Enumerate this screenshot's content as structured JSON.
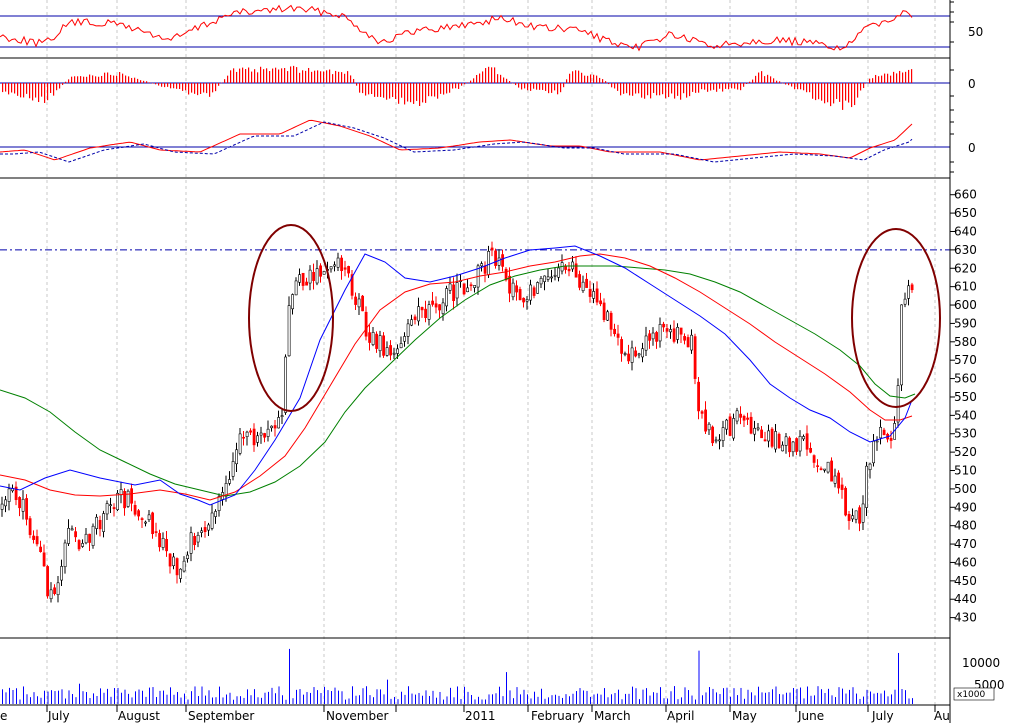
{
  "chart_data": [
    {
      "type": "line",
      "panel": "oscillator",
      "levels": [
        70,
        30
      ],
      "ytick_labels": [
        "50"
      ],
      "color": "#ff0000"
    },
    {
      "type": "bar",
      "panel": "macd-histogram",
      "ytick_labels": [
        "0"
      ],
      "color": "#ff0000"
    },
    {
      "type": "line",
      "panel": "macd",
      "ytick_labels": [
        "0"
      ],
      "series": [
        {
          "style": "solid",
          "color": "#ff0000"
        },
        {
          "style": "dashed",
          "color": "#0000aa"
        }
      ]
    },
    {
      "type": "candlestick",
      "panel": "price",
      "y_range": [
        420,
        668
      ],
      "yticks": [
        660,
        650,
        640,
        630,
        620,
        610,
        600,
        590,
        580,
        570,
        560,
        550,
        540,
        530,
        520,
        510,
        500,
        490,
        480,
        470,
        460,
        450,
        440,
        430
      ],
      "ytick_labels": [
        "660",
        "650",
        "640",
        "630",
        "620",
        "610",
        "600",
        "590",
        "580",
        "570",
        "560",
        "550",
        "540",
        "530",
        "520",
        "510",
        "500",
        "490",
        "480",
        "470",
        "460",
        "450",
        "440",
        "430"
      ],
      "resistance_line": 630,
      "x_labels": [
        "e",
        "July",
        "August",
        "September",
        "November",
        "2011",
        "February",
        "March",
        "April",
        "May",
        "June",
        "July",
        "Au"
      ],
      "colors": {
        "up": "#000000",
        "down": "#ff0000",
        "ma_short": "#0000ff",
        "ma_mid": "#ff0000",
        "ma_long": "#008000",
        "circle": "#800000"
      },
      "moving_averages": {
        "short": [
          [
            0,
            486
          ],
          [
            20,
            490
          ],
          [
            45,
            478
          ],
          [
            70,
            470
          ],
          [
            100,
            478
          ],
          [
            135,
            485
          ],
          [
            160,
            480
          ],
          [
            180,
            494
          ],
          [
            198,
            500
          ],
          [
            210,
            505
          ],
          [
            235,
            495
          ],
          [
            255,
            470
          ],
          [
            275,
            440
          ],
          [
            300,
            398
          ],
          [
            320,
            340
          ],
          [
            345,
            290
          ],
          [
            365,
            254
          ],
          [
            385,
            262
          ],
          [
            405,
            278
          ],
          [
            430,
            282
          ],
          [
            455,
            276
          ],
          [
            480,
            268
          ],
          [
            505,
            258
          ],
          [
            530,
            250
          ],
          [
            555,
            248
          ],
          [
            575,
            246
          ],
          [
            600,
            256
          ],
          [
            625,
            268
          ],
          [
            650,
            284
          ],
          [
            675,
            300
          ],
          [
            700,
            316
          ],
          [
            725,
            334
          ],
          [
            750,
            360
          ],
          [
            770,
            384
          ],
          [
            790,
            398
          ],
          [
            810,
            410
          ],
          [
            830,
            418
          ],
          [
            850,
            432
          ],
          [
            870,
            442
          ],
          [
            890,
            436
          ],
          [
            905,
            418
          ],
          [
            912,
            400
          ]
        ],
        "mid": [
          [
            0,
            475
          ],
          [
            25,
            480
          ],
          [
            50,
            490
          ],
          [
            75,
            495
          ],
          [
            100,
            496
          ],
          [
            130,
            494
          ],
          [
            160,
            490
          ],
          [
            185,
            494
          ],
          [
            210,
            500
          ],
          [
            235,
            492
          ],
          [
            260,
            476
          ],
          [
            285,
            456
          ],
          [
            305,
            428
          ],
          [
            330,
            386
          ],
          [
            355,
            344
          ],
          [
            380,
            310
          ],
          [
            405,
            292
          ],
          [
            430,
            284
          ],
          [
            455,
            282
          ],
          [
            480,
            276
          ],
          [
            505,
            272
          ],
          [
            530,
            266
          ],
          [
            555,
            262
          ],
          [
            580,
            256
          ],
          [
            600,
            254
          ],
          [
            625,
            258
          ],
          [
            650,
            266
          ],
          [
            675,
            278
          ],
          [
            700,
            292
          ],
          [
            725,
            308
          ],
          [
            750,
            324
          ],
          [
            775,
            342
          ],
          [
            800,
            358
          ],
          [
            825,
            374
          ],
          [
            850,
            392
          ],
          [
            870,
            410
          ],
          [
            885,
            420
          ],
          [
            900,
            420
          ],
          [
            912,
            416
          ]
        ],
        "long": [
          [
            0,
            390
          ],
          [
            25,
            398
          ],
          [
            50,
            412
          ],
          [
            75,
            432
          ],
          [
            100,
            450
          ],
          [
            125,
            462
          ],
          [
            150,
            474
          ],
          [
            175,
            484
          ],
          [
            200,
            490
          ],
          [
            225,
            496
          ],
          [
            250,
            492
          ],
          [
            275,
            482
          ],
          [
            300,
            466
          ],
          [
            325,
            442
          ],
          [
            345,
            412
          ],
          [
            365,
            388
          ],
          [
            390,
            364
          ],
          [
            415,
            340
          ],
          [
            440,
            318
          ],
          [
            465,
            300
          ],
          [
            490,
            285
          ],
          [
            515,
            276
          ],
          [
            540,
            270
          ],
          [
            565,
            266
          ],
          [
            590,
            266
          ],
          [
            615,
            266
          ],
          [
            640,
            268
          ],
          [
            665,
            270
          ],
          [
            690,
            274
          ],
          [
            715,
            282
          ],
          [
            740,
            292
          ],
          [
            765,
            306
          ],
          [
            790,
            320
          ],
          [
            815,
            334
          ],
          [
            840,
            350
          ],
          [
            860,
            366
          ],
          [
            875,
            384
          ],
          [
            890,
            396
          ],
          [
            905,
            398
          ],
          [
            915,
            394
          ]
        ]
      },
      "annotations": [
        "ellipse-september",
        "ellipse-july"
      ]
    },
    {
      "type": "bar",
      "panel": "volume",
      "ytick_labels": [
        "10000",
        "5000"
      ],
      "unit_label": "x1000",
      "color": "#0000ff"
    }
  ]
}
